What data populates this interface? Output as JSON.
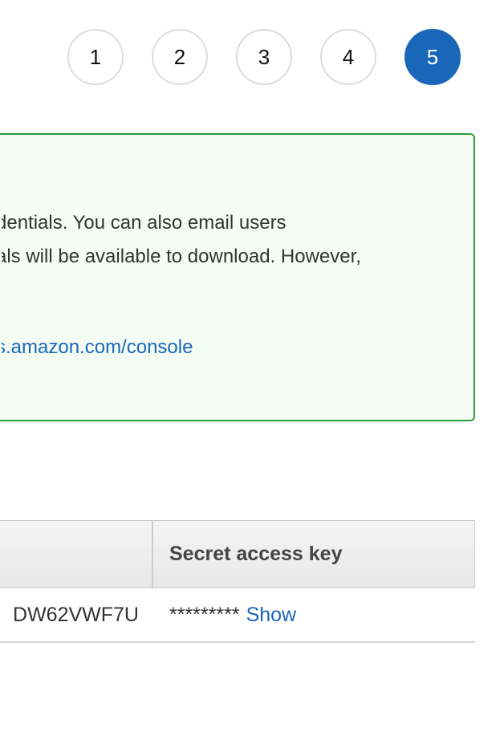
{
  "wizard": {
    "steps": [
      "1",
      "2",
      "3",
      "4",
      "5"
    ],
    "active_step": "5"
  },
  "alert": {
    "line1": "dentials. You can also email users",
    "line2": "als will be available to download. However,",
    "link": "s.amazon.com/console"
  },
  "table": {
    "headers": [
      "",
      "Secret access key"
    ],
    "rows": [
      {
        "access_key_id": "DW62VWF7U",
        "secret_masked": "*********",
        "show_label": "Show"
      }
    ]
  },
  "colors": {
    "accent": "#1a66b8",
    "alert_border": "#2e9b3e",
    "alert_background": "#f4fdf4"
  }
}
